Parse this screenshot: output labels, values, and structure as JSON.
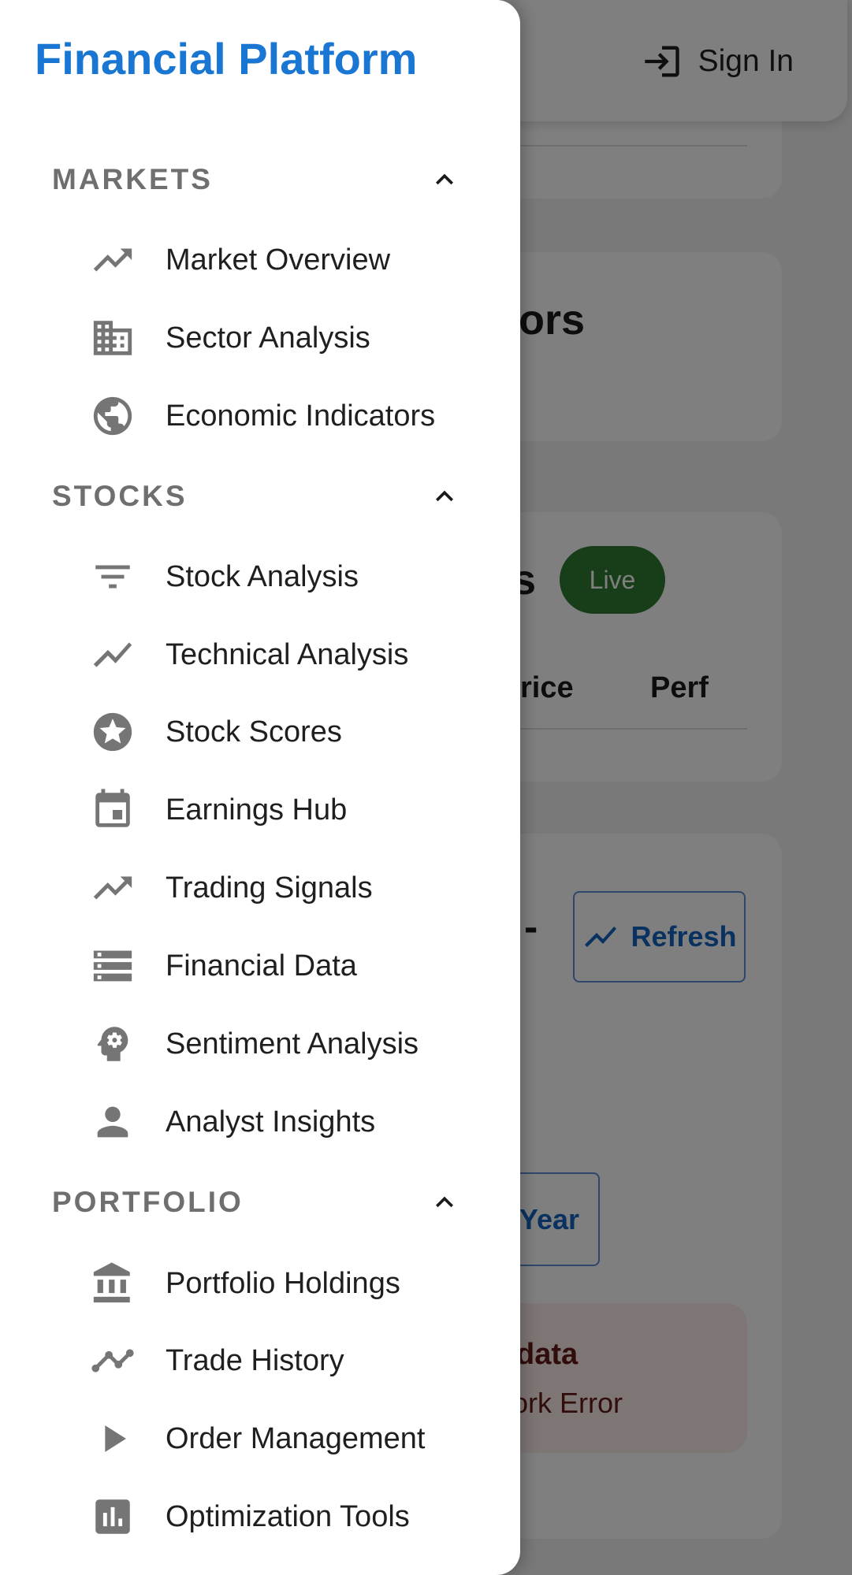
{
  "drawer": {
    "brand": "Financial Platform",
    "sections": [
      {
        "title": "MARKETS",
        "items": [
          {
            "label": "Market Overview",
            "icon": "trending-up-icon"
          },
          {
            "label": "Sector Analysis",
            "icon": "business-icon"
          },
          {
            "label": "Economic Indicators",
            "icon": "public-icon"
          }
        ]
      },
      {
        "title": "STOCKS",
        "items": [
          {
            "label": "Stock Analysis",
            "icon": "filter-list-icon"
          },
          {
            "label": "Technical Analysis",
            "icon": "show-chart-icon"
          },
          {
            "label": "Stock Scores",
            "icon": "stars-icon"
          },
          {
            "label": "Earnings Hub",
            "icon": "event-icon"
          },
          {
            "label": "Trading Signals",
            "icon": "trending-up-icon"
          },
          {
            "label": "Financial Data",
            "icon": "storage-icon"
          },
          {
            "label": "Sentiment Analysis",
            "icon": "psychology-icon"
          },
          {
            "label": "Analyst Insights",
            "icon": "person-icon"
          }
        ]
      },
      {
        "title": "PORTFOLIO",
        "items": [
          {
            "label": "Portfolio Holdings",
            "icon": "account-balance-icon"
          },
          {
            "label": "Trade History",
            "icon": "timeline-icon"
          },
          {
            "label": "Order Management",
            "icon": "play-arrow-icon"
          },
          {
            "label": "Optimization Tools",
            "icon": "assessment-icon"
          }
        ]
      }
    ]
  },
  "header": {
    "signin_label": "Sign In"
  },
  "background": {
    "indicators_title_fragment": "tors",
    "movers_title_fragment": "s",
    "live_badge": "Live",
    "col_price_fragment": "rice",
    "col_perf": "Perf",
    "signals_title_fragment": "-",
    "refresh_label": "Refresh",
    "year_label": "Year",
    "error_title_fragment": "data",
    "error_detail_fragment": "vork Error"
  },
  "colors": {
    "brand": "#1976d2",
    "live": "#2e7d32",
    "error_bg": "#fdecea"
  }
}
